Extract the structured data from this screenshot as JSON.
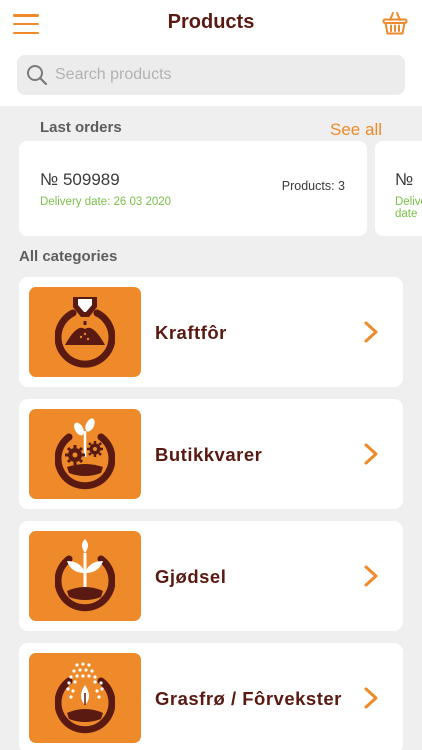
{
  "header": {
    "title": "Products",
    "menu_icon": "hamburger-menu-icon",
    "cart_icon": "basket-icon"
  },
  "search": {
    "placeholder": "Search products"
  },
  "last_orders": {
    "label": "Last orders",
    "see_all": "See all",
    "orders": [
      {
        "number": "№ 509989",
        "delivery": "Delivery date: 26 03 2020",
        "products": "Products: 3"
      },
      {
        "number": "№",
        "delivery": "Delivery date"
      }
    ]
  },
  "categories": {
    "label": "All categories",
    "items": [
      {
        "label": "Kraftfôr",
        "icon": "feed-silo-icon"
      },
      {
        "label": "Butikkvarer",
        "icon": "gears-plant-icon"
      },
      {
        "label": "Gjødsel",
        "icon": "sprout-icon"
      },
      {
        "label": "Grasfrø / Fôrvekster",
        "icon": "seeds-icon"
      }
    ]
  },
  "colors": {
    "accent": "#ee8a2a",
    "title": "#5a1a12",
    "delivery_green": "#7cc04a",
    "background": "#efefef"
  }
}
